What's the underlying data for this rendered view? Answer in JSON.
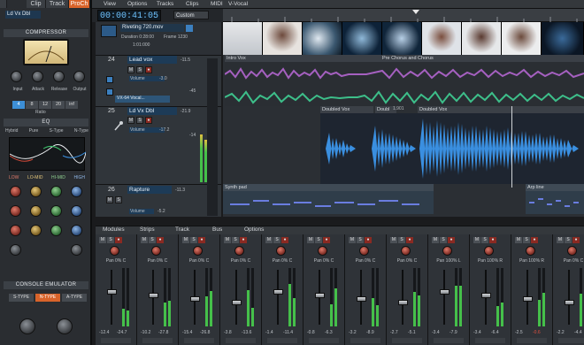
{
  "inspector": {
    "tabs": [
      "Clip",
      "Track",
      "ProCh"
    ],
    "active_tab": "ProCh",
    "track_name": "Ld Vx Dbl",
    "compressor_title": "COMPRESSOR",
    "comp_knobs": [
      "Input",
      "Attack",
      "Release",
      "Output"
    ],
    "ratios": [
      "4",
      "8",
      "12",
      "20",
      "inf"
    ],
    "ratio_label": "Ratio",
    "eq_title": "EQ",
    "eq_modes": [
      "Hybrid",
      "Pure",
      "S-Type",
      "N-Type"
    ],
    "eq_bands": [
      "LOW",
      "LO-MID",
      "HI-MID",
      "HIGH"
    ],
    "console_title": "CONSOLE EMULATOR",
    "console_types": [
      "S-TYPE",
      "N-TYPE",
      "A-TYPE"
    ],
    "active_console": "N-TYPE"
  },
  "menubar": {
    "items": [
      "View",
      "Options",
      "Tracks",
      "Clips",
      "MIDI",
      "V-Vocal"
    ]
  },
  "transport": {
    "timecode": "00:00:41:05",
    "preset": "Custom"
  },
  "video": {
    "label": "Riveting 720.mov",
    "line2": "Duration 0:28:00",
    "line3": "Frame 1230",
    "line4": "1:01:000"
  },
  "tracks": [
    {
      "num": "24",
      "name": "Lead vox",
      "vol": "-11.5",
      "fx_label": "Volume",
      "fx_value": "-3.0",
      "plug": "VX-64 Vocal...",
      "meter": "-45"
    },
    {
      "num": "25",
      "name": "Ld Vx Dbl",
      "vol": "-21.9",
      "fx_label": "Volume",
      "fx_value": "-17.2",
      "meter": "-14"
    },
    {
      "num": "26",
      "name": "Rapture",
      "vol": "-11.3",
      "fx_label": "Volume",
      "fx_value": "-5.2",
      "meter": ""
    }
  ],
  "clips": {
    "lane1": [
      "Intro Vox",
      "Pre Chorus and Chorus"
    ],
    "lane2": [
      "Doubled Vox",
      "Doubl",
      "Doubled Vox"
    ],
    "lane2_meter": "1.901",
    "lane3": [
      "Synth pad",
      "Arp line"
    ]
  },
  "console": {
    "tabs": [
      "Modules",
      "Strips",
      "Track",
      "Bus",
      "Options"
    ],
    "strips": [
      {
        "pan": "Pan  0% C",
        "val1": "-12.4",
        "val2": "-24.7"
      },
      {
        "pan": "Pan  0% C",
        "val1": "-10.2",
        "val2": "-27.8"
      },
      {
        "pan": "Pan  0% C",
        "val1": "-15.4",
        "val2": "-26.8"
      },
      {
        "pan": "Pan  0% C",
        "val1": "-3.8",
        "val2": "-13.6"
      },
      {
        "pan": "Pan  0% C",
        "val1": "-1.4",
        "val2": "-11.4"
      },
      {
        "pan": "Pan  0% C",
        "val1": "-0.8",
        "val2": "-6.3"
      },
      {
        "pan": "Pan  0% C",
        "val1": "-3.2",
        "val2": "-8.9"
      },
      {
        "pan": "Pan  0% C",
        "val1": "-2.7",
        "val2": "-5.1"
      },
      {
        "pan": "Pan 100% L",
        "val1": "-3.4",
        "val2": "-7.9"
      },
      {
        "pan": "Pan 100% R",
        "val1": "-3.4",
        "val2": "-6.4"
      },
      {
        "pan": "Pan 100% R",
        "val1": "-2.5",
        "val2": "-0.6"
      },
      {
        "pan": "Pan  0% C",
        "val1": "-2.2",
        "val2": "-4.4"
      }
    ]
  },
  "colors": {
    "accent": "#d8632a",
    "timecode": "#6ec3ff",
    "waveform_purple": "#a560c0",
    "waveform_green": "#3dbf8a",
    "waveform_blue": "#3a8fe0"
  }
}
